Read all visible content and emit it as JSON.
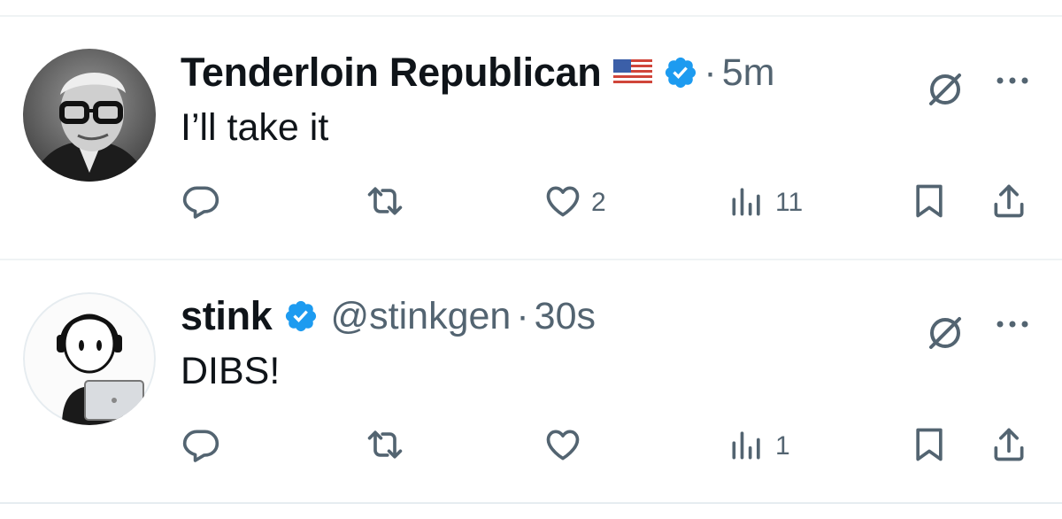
{
  "tweets": [
    {
      "display_name": "Tenderloin Republican",
      "flag": "🇺🇸",
      "handle": "",
      "separator": "·",
      "time": "5m",
      "text": "I’ll take it",
      "replies": "",
      "reposts": "",
      "likes": "2",
      "views": "11"
    },
    {
      "display_name": "stink",
      "handle": "@stinkgen",
      "separator": "·",
      "time": "30s",
      "text": "DIBS!",
      "replies": "",
      "reposts": "",
      "likes": "",
      "views": "1"
    }
  ],
  "colors": {
    "text_primary": "#0f1419",
    "text_secondary": "#536471",
    "verified_blue": "#1d9bf0",
    "divider": "#eff3f4"
  },
  "icons": [
    "verified-badge-icon",
    "grok-icon",
    "more-icon",
    "reply-icon",
    "repost-icon",
    "like-icon",
    "views-icon",
    "bookmark-icon",
    "share-icon"
  ]
}
